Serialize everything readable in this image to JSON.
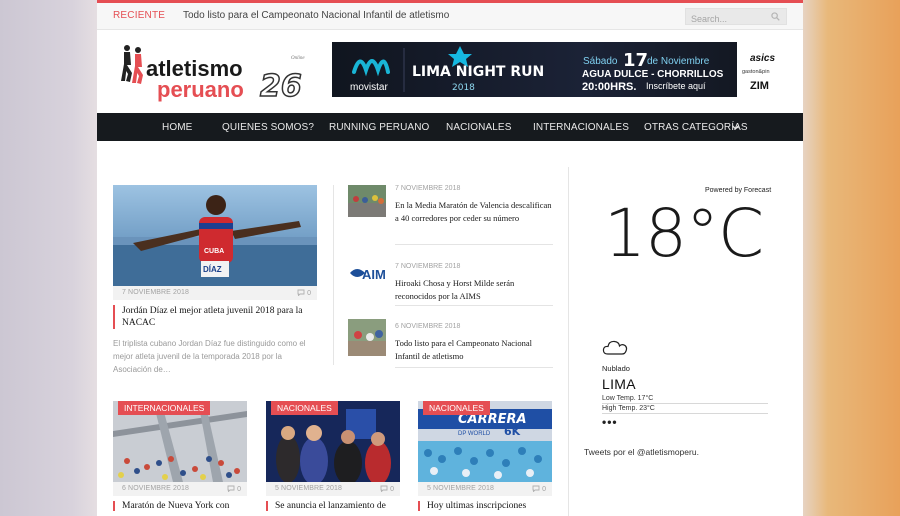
{
  "topbar": {
    "recent_label": "RECIENTE",
    "recent_headline": "Todo listo para el Campeonato Nacional Infantil de atletismo",
    "search_placeholder": "Search..."
  },
  "logo": {
    "line1": "atletismo",
    "line2": "peruano",
    "number": "26",
    "tagline": "Online"
  },
  "banner": {
    "brand": "movistar",
    "event": "LIMA NIGHT RUN",
    "year": "2018",
    "date_prefix": "Sábado",
    "day": "17",
    "month": "de Noviembre",
    "location": "AGUA DULCE - CHORRILLOS",
    "time": "20:00HRS.",
    "cta": "Inscríbete aquí",
    "sponsors": [
      "asics",
      "gaston&pin",
      "ZIM"
    ]
  },
  "nav": {
    "items": [
      {
        "label": "HOME"
      },
      {
        "label": "QUIENES SOMOS?"
      },
      {
        "label": "RUNNING PERUANO"
      },
      {
        "label": "NACIONALES"
      },
      {
        "label": "INTERNACIONALES"
      },
      {
        "label": "OTRAS CATEGORÍAS"
      }
    ]
  },
  "featured": {
    "date": "7 NOVIEMBRE 2018",
    "comments": "0",
    "title_line1": "Jordán Díaz el mejor atleta juvenil 2018 para la",
    "title_line2": "NACAC",
    "excerpt": "El triplista cubano Jordan Díaz fue distinguido como el mejor atleta juvenil de la temporada 2018 por la Asociación de…",
    "jersey_text": "CUBA",
    "bib_text": "DÍAZ"
  },
  "side_articles": [
    {
      "date": "7 NOVIEMBRE 2018",
      "title": "En la Media Maratón de Valencia descalifican a 40 corredores por ceder su número"
    },
    {
      "date": "7 NOVIEMBRE 2018",
      "title": "Hiroaki Chosa y Horst Milde serán reconocidos por la AIMS",
      "thumb_text": "AIM"
    },
    {
      "date": "6 NOVIEMBRE 2018",
      "title": "Todo listo para el Campeonato Nacional Infantil de atletismo"
    }
  ],
  "cards": [
    {
      "tag": "INTERNACIONALES",
      "date": "6 NOVIEMBRE 2018",
      "comments": "0",
      "title": "Maratón de Nueva York con"
    },
    {
      "tag": "NACIONALES",
      "date": "5 NOVIEMBRE 2018",
      "comments": "0",
      "title": "Se anuncia el lanzamiento de"
    },
    {
      "tag": "NACIONALES",
      "date": "5 NOVIEMBRE 2018",
      "comments": "0",
      "title": "Hoy ultimas inscripciones",
      "img_text1": "CARRERA",
      "img_text2": "DP WORLD",
      "img_text3": "6K"
    }
  ],
  "weather": {
    "powered_by": "Powered by Forecast",
    "temperature": "18°C",
    "condition": "Nublado",
    "city": "LIMA",
    "low": "Low Temp. 17°C",
    "high": "High Temp. 23°C",
    "more": "•••"
  },
  "tweets": {
    "label": "Tweets por el @atletismoperu."
  },
  "colors": {
    "accent": "#e54e53",
    "nav_bg": "#161a1e"
  }
}
